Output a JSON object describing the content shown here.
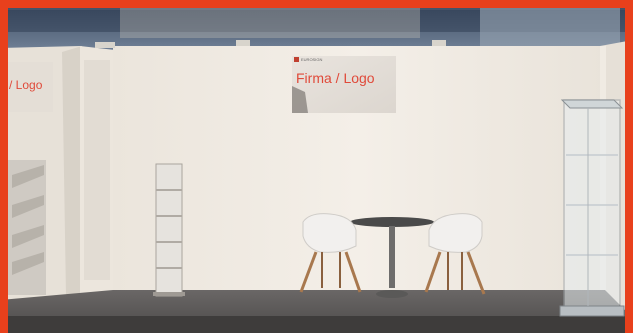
{
  "signs": {
    "main_title": "Firma / Logo",
    "left_title": "/ Logo",
    "brand_label": "EUROSIGN"
  },
  "colors": {
    "frame": "#e8401c",
    "wall": "#f1ece4",
    "floor": "#5a5756",
    "sign_text": "#e04a3a"
  }
}
